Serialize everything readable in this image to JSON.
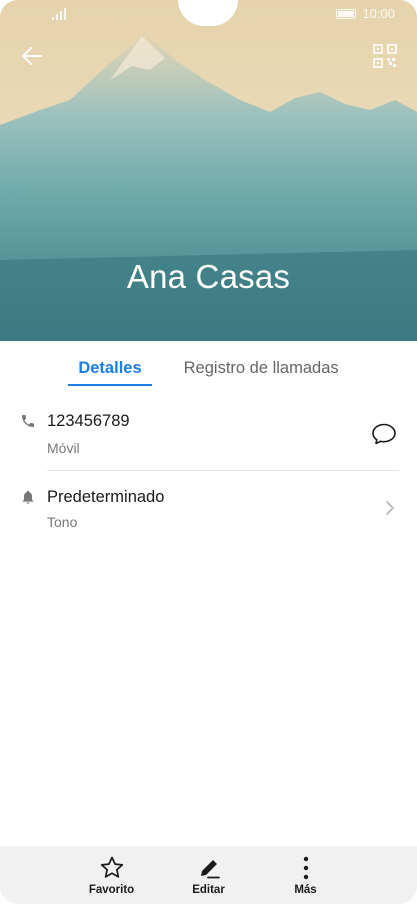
{
  "status_bar": {
    "time": "10:00"
  },
  "header": {
    "contact_name": "Ana Casas",
    "back_icon": "arrow-left-icon",
    "qr_icon": "qr-code-icon"
  },
  "tabs": [
    {
      "label": "Detalles",
      "active": true
    },
    {
      "label": "Registro de llamadas",
      "active": false
    }
  ],
  "details": {
    "phone": {
      "number": "123456789",
      "type": "Móvil",
      "icon": "phone-icon",
      "action_icon": "message-icon"
    },
    "ringtone": {
      "value": "Predeterminado",
      "label": "Tono",
      "icon": "bell-icon"
    }
  },
  "bottom_bar": {
    "favorite": "Favorito",
    "edit": "Editar",
    "more": "Más"
  },
  "colors": {
    "accent": "#1b7ee6",
    "bottom_bar_bg": "#f1f1f1"
  }
}
